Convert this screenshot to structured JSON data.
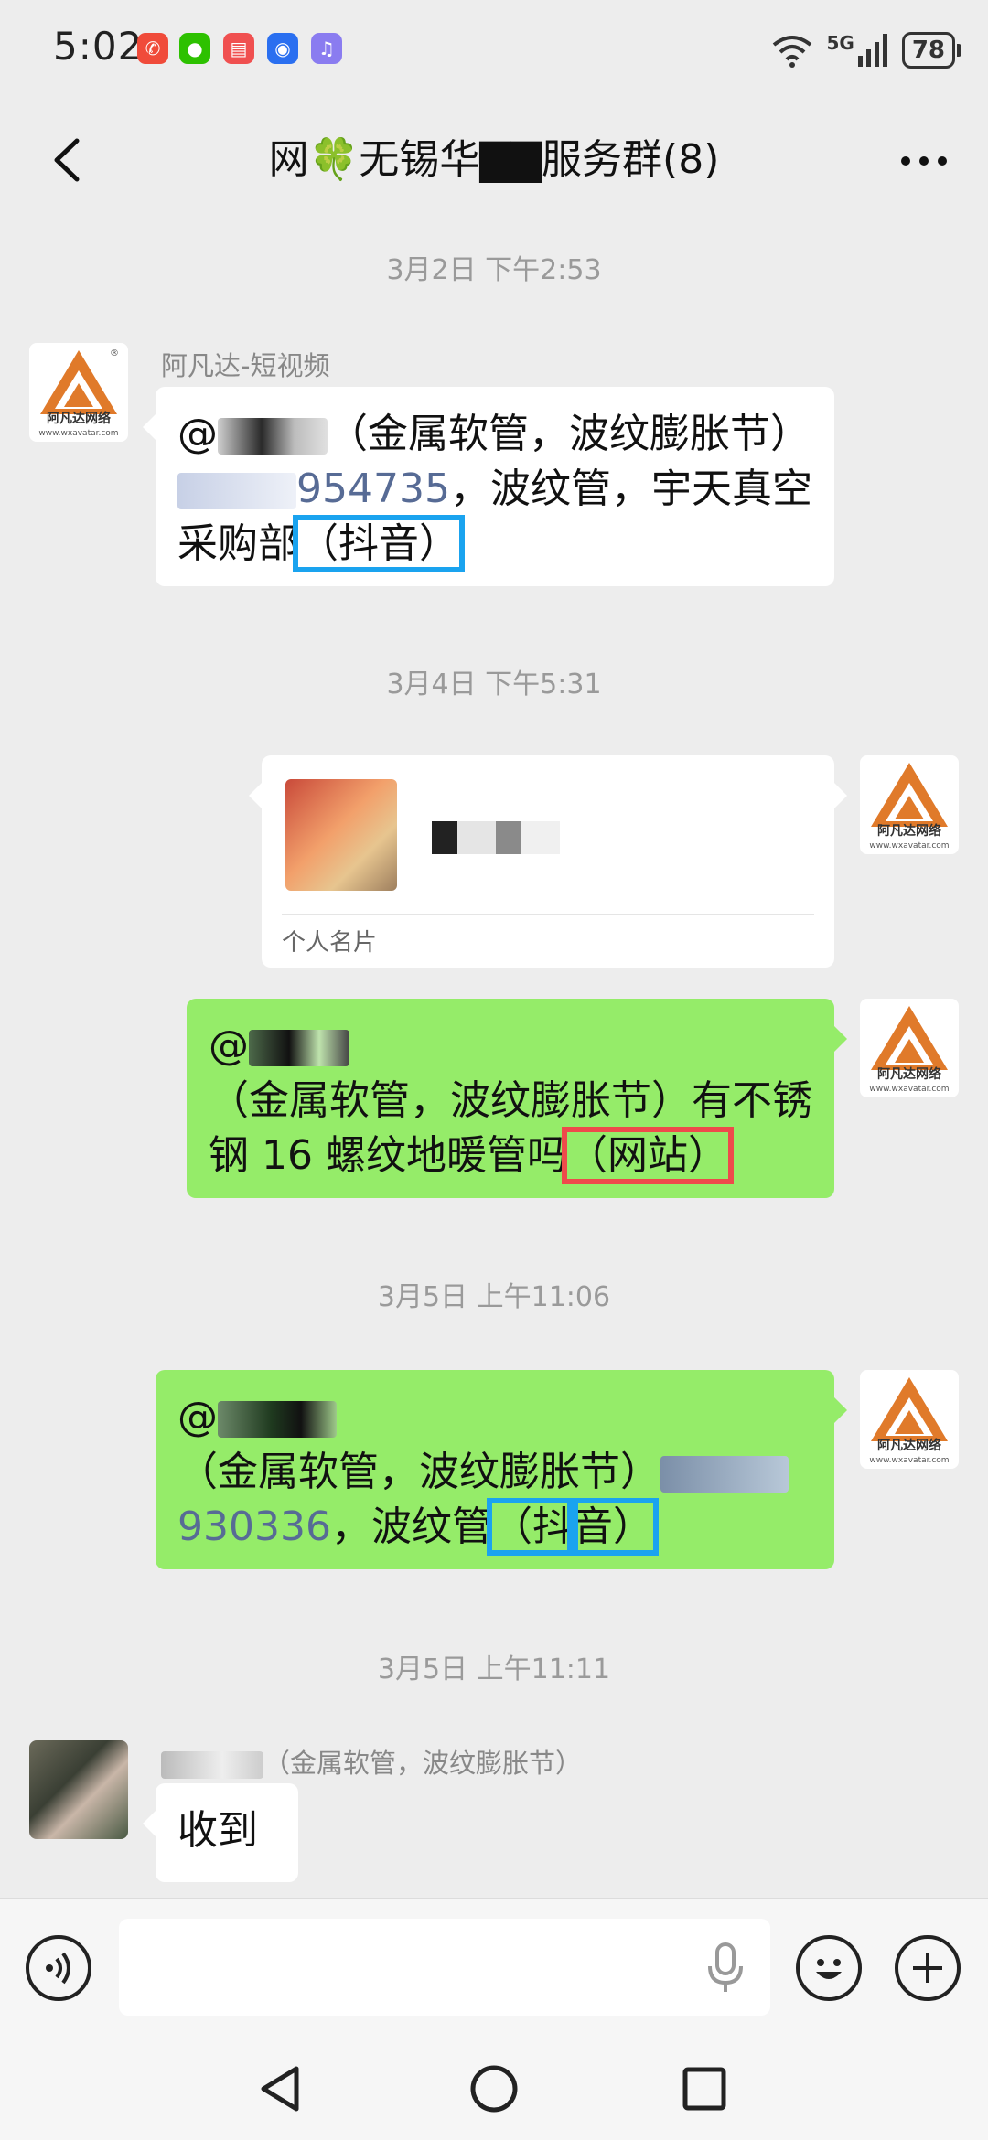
{
  "status_bar": {
    "time": "5:02",
    "network": "5G",
    "battery": "78"
  },
  "header": {
    "title": "网🍀无锡华▇▇服务群(8)"
  },
  "messages": {
    "ts1": "3月2日 下午2:53",
    "m1_sender": "阿凡达-短视频",
    "m1_text_a": "（金属软管，波纹膨胀节）",
    "m1_num_visible": "954735",
    "m1_text_b": "，波纹管，宇天真空采购部",
    "m1_tag": "（抖音）",
    "ts2": "3月4日 下午5:31",
    "card_label": "个人名片",
    "m3_text_a": "（金属软管，波纹膨胀节）",
    "m3_text_b": "有不锈钢 16 螺纹地暖管吗",
    "m3_tag": "（网站）",
    "ts3": "3月5日 上午11:06",
    "m4_text_a": "（金属软管，波纹膨胀节）",
    "m4_num_visible": "930336",
    "m4_text_b": "，波纹管",
    "m4_tag_1": "（抖",
    "m4_tag_2": "音）",
    "ts4": "3月5日 上午11:11",
    "m5_sender_suffix": "（金属软管，波纹膨胀节）",
    "m5_text": "收到"
  },
  "avatar": {
    "brand": "阿凡达网络",
    "url": "www.wxavatar.com"
  },
  "input": {
    "placeholder": ""
  },
  "colors": {
    "bubble_green": "#95ec69",
    "highlight_blue": "#1aa3ef",
    "highlight_red": "#ee4b4b",
    "link": "#576b95"
  }
}
